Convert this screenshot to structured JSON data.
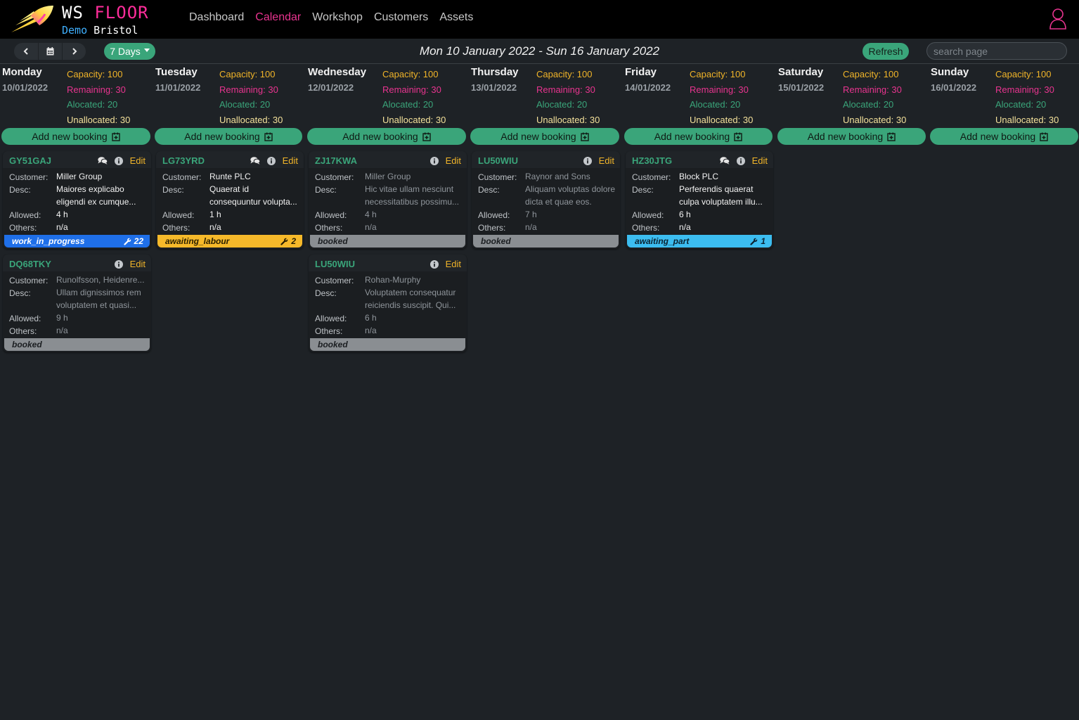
{
  "app": {
    "logo_ws": "WS",
    "logo_floor": "FLOOR",
    "logo_demo": "Demo",
    "logo_location": "Bristol",
    "user_icon": "user-icon",
    "accent_color": "#3aa57a",
    "brand_pink": "#e8348f"
  },
  "nav": {
    "dashboard": "Dashboard",
    "calendar": "Calendar",
    "workshop": "Workshop",
    "customers": "Customers",
    "assets": "Assets",
    "active": "Calendar"
  },
  "toolbar": {
    "prev_icon": "chevron-left-icon",
    "calendar_icon": "calendar-icon",
    "next_icon": "chevron-right-icon",
    "view_select": "7 Days",
    "range_title": "Mon 10 January 2022 - Sun 16 January 2022",
    "refresh_label": "Refresh",
    "search_placeholder": "search page"
  },
  "days": [
    {
      "name": "Monday",
      "date": "10/01/2022",
      "capacity": "Capacity: 100",
      "remaining": "Remaining: 30",
      "allocated": "Alocated: 20",
      "unallocated": "Unallocated: 30",
      "add_label": "Add new booking"
    },
    {
      "name": "Tuesday",
      "date": "11/01/2022",
      "capacity": "Capacity: 100",
      "remaining": "Remaining: 30",
      "allocated": "Alocated: 20",
      "unallocated": "Unallocated: 30",
      "add_label": "Add new booking"
    },
    {
      "name": "Wednesday",
      "date": "12/01/2022",
      "capacity": "Capacity: 100",
      "remaining": "Remaining: 30",
      "allocated": "Alocated: 20",
      "unallocated": "Unallocated: 30",
      "add_label": "Add new booking"
    },
    {
      "name": "Thursday",
      "date": "13/01/2022",
      "capacity": "Capacity: 100",
      "remaining": "Remaining: 30",
      "allocated": "Alocated: 20",
      "unallocated": "Unallocated: 30",
      "add_label": "Add new booking"
    },
    {
      "name": "Friday",
      "date": "14/01/2022",
      "capacity": "Capacity: 100",
      "remaining": "Remaining: 30",
      "allocated": "Alocated: 20",
      "unallocated": "Unallocated: 30",
      "add_label": "Add new booking"
    },
    {
      "name": "Saturday",
      "date": "15/01/2022",
      "capacity": "Capacity: 100",
      "remaining": "Remaining: 30",
      "allocated": "Alocated: 20",
      "unallocated": "Unallocated: 30",
      "add_label": "Add new booking"
    },
    {
      "name": "Sunday",
      "date": "16/01/2022",
      "capacity": "Capacity: 100",
      "remaining": "Remaining: 30",
      "allocated": "Alocated: 20",
      "unallocated": "Unallocated: 30",
      "add_label": "Add new booking"
    }
  ],
  "labels": {
    "customer": "Customer:",
    "desc": "Desc:",
    "allowed": "Allowed:",
    "others": "Others:",
    "edit": "Edit"
  },
  "bookings": [
    {
      "reg": "GY51GAJ",
      "customer": "Miller Group",
      "desc1": "Maiores explicabo",
      "desc2": "eligendi ex cumque...",
      "allowed": "4 h",
      "others": "n/a",
      "status": "work_in_progress",
      "count": "22"
    },
    {
      "reg": "DQ68TKY",
      "customer": "Runolfsson, Heidenre...",
      "desc1": "Ullam dignissimos rem",
      "desc2": "voluptatem et quasi...",
      "allowed": "9 h",
      "others": "n/a",
      "status": "booked"
    },
    {
      "reg": "LG73YRD",
      "customer": "Runte PLC",
      "desc1": "Quaerat id",
      "desc2": "consequuntur volupta...",
      "allowed": "1 h",
      "others": "n/a",
      "status": "awaiting_labour",
      "count": "2"
    },
    {
      "reg": "ZJ17KWA",
      "customer": "Miller Group",
      "desc1": "Hic vitae ullam nesciunt",
      "desc2": "necessitatibus possimu...",
      "allowed": "4 h",
      "others": "n/a",
      "status": "booked"
    },
    {
      "reg": "LU50WIU",
      "customer": "Rohan-Murphy",
      "desc1": "Voluptatem consequatur",
      "desc2": "reiciendis suscipit. Qui...",
      "allowed": "6 h",
      "others": "n/a",
      "status": "booked"
    },
    {
      "reg": "LU50WIU",
      "customer": "Raynor and Sons",
      "desc1": "Aliquam voluptas dolore",
      "desc2": "dicta et quae eos.",
      "allowed": "7 h",
      "others": "n/a",
      "status": "booked"
    },
    {
      "reg": "HZ30JTG",
      "customer": "Block PLC",
      "desc1": "Perferendis quaerat",
      "desc2": "culpa voluptatem illu...",
      "allowed": "6 h",
      "others": "n/a",
      "status": "awaiting_part",
      "count": "1"
    }
  ],
  "status_colors": {
    "work_in_progress": "#1f6fe8",
    "awaiting_labour": "#f6b92a",
    "awaiting_part": "#3cbdf0",
    "booked": "#8a8e92"
  }
}
